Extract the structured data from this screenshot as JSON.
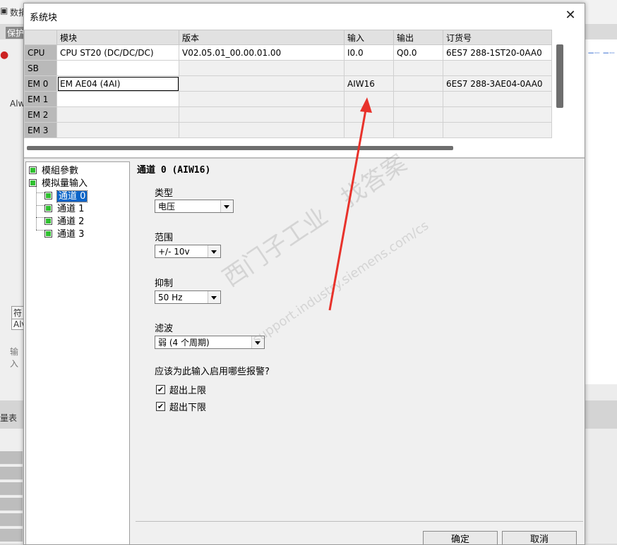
{
  "background_app": {
    "top_label": "数捐",
    "toolbar_label": "保护",
    "left_labels": [
      "Alw",
      "符",
      "Alv",
      "输入"
    ],
    "bottom_label": "量表",
    "right_icons": [
      "−┈ −┈"
    ]
  },
  "dialog": {
    "title": "系统块",
    "close_symbol": "✕"
  },
  "grid": {
    "columns": [
      "模块",
      "版本",
      "输入",
      "输出",
      "订货号"
    ],
    "rows": [
      {
        "slot": "CPU",
        "module": "CPU ST20 (DC/DC/DC)",
        "version": "V02.05.01_00.00.01.00",
        "input": "I0.0",
        "output": "Q0.0",
        "order": "6ES7 288-1ST20-0AA0"
      },
      {
        "slot": "SB",
        "module": "",
        "version": "",
        "input": "",
        "output": "",
        "order": ""
      },
      {
        "slot": "EM 0",
        "module": "EM AE04 (4AI)",
        "version": "",
        "input": "AIW16",
        "output": "",
        "order": "6ES7 288-3AE04-0AA0"
      },
      {
        "slot": "EM 1",
        "module": "",
        "version": "",
        "input": "",
        "output": "",
        "order": ""
      },
      {
        "slot": "EM 2",
        "module": "",
        "version": "",
        "input": "",
        "output": "",
        "order": ""
      },
      {
        "slot": "EM 3",
        "module": "",
        "version": "",
        "input": "",
        "output": "",
        "order": ""
      }
    ]
  },
  "tree": {
    "items": [
      "模組參數",
      "模拟量输入",
      "通道 0",
      "通道 1",
      "通道 2",
      "通道 3"
    ]
  },
  "panel": {
    "channel_title": "通道 0 (AIW16)",
    "type_label": "类型",
    "type_value": "电压",
    "range_label": "范围",
    "range_value": "+/- 10v",
    "suppress_label": "抑制",
    "suppress_value": "50 Hz",
    "filter_label": "滤波",
    "filter_value": "弱 (4 个周期)",
    "alarm_question": "应该为此输入启用哪些报警?",
    "alarm_upper": "超出上限",
    "alarm_lower": "超出下限",
    "alarm_upper_checked": true,
    "alarm_lower_checked": true,
    "check_mark": "✔"
  },
  "buttons": {
    "ok": "确定",
    "cancel": "取消"
  },
  "watermark": {
    "line1": "西门子工业",
    "line1b": "找答案",
    "line2": "support.industry.siemens.com/cs"
  },
  "colors": {
    "arrow": "#e8322b",
    "tree_selection": "#0a64c8",
    "checkbox_green": "#2fc02f"
  }
}
